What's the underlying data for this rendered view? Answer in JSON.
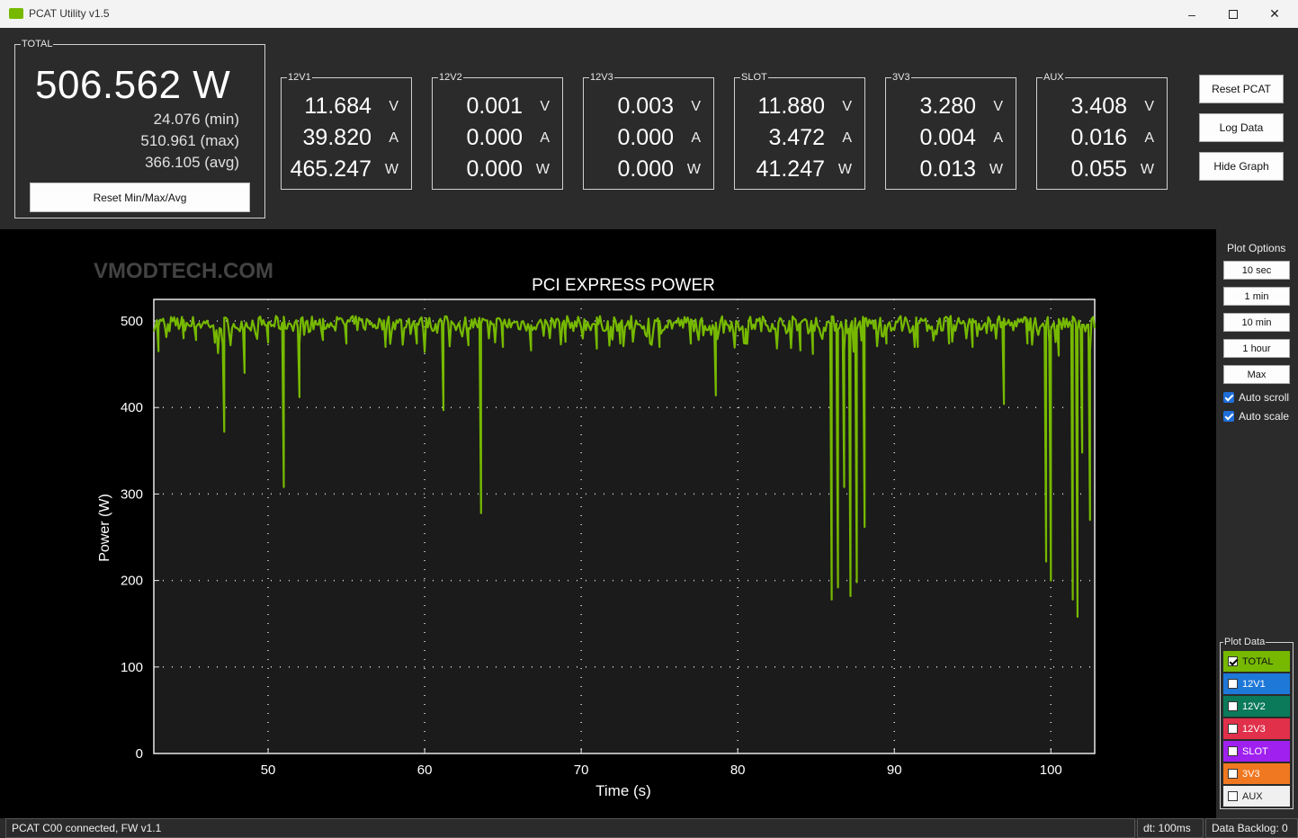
{
  "window": {
    "title": "PCAT Utility v1.5"
  },
  "total": {
    "label": "TOTAL",
    "watts": "506.562 W",
    "min": "24.076 (min)",
    "max": "510.961 (max)",
    "avg": "366.105 (avg)",
    "reset_label": "Reset Min/Max/Avg"
  },
  "rails": [
    {
      "name": "12V1",
      "volts": "11.684",
      "amps": "39.820",
      "watts": "465.247"
    },
    {
      "name": "12V2",
      "volts": "0.001",
      "amps": "0.000",
      "watts": "0.000"
    },
    {
      "name": "12V3",
      "volts": "0.003",
      "amps": "0.000",
      "watts": "0.000"
    },
    {
      "name": "SLOT",
      "volts": "11.880",
      "amps": "3.472",
      "watts": "41.247"
    },
    {
      "name": "3V3",
      "volts": "3.280",
      "amps": "0.004",
      "watts": "0.013"
    },
    {
      "name": "AUX",
      "volts": "3.408",
      "amps": "0.016",
      "watts": "0.055"
    }
  ],
  "units": {
    "v": "V",
    "a": "A",
    "w": "W"
  },
  "actions": {
    "reset_pcat": "Reset PCAT",
    "log_data": "Log Data",
    "hide_graph": "Hide Graph"
  },
  "plot_options": {
    "title": "Plot Options",
    "ranges": [
      "10 sec",
      "1 min",
      "10 min",
      "1 hour",
      "Max"
    ],
    "auto_scroll": "Auto scroll",
    "auto_scale": "Auto scale"
  },
  "plot_data": {
    "title": "Plot Data",
    "items": [
      {
        "label": "TOTAL",
        "color": "#76b900",
        "checked": true
      },
      {
        "label": "12V1",
        "color": "#1e78d8",
        "checked": false
      },
      {
        "label": "12V2",
        "color": "#0a7a5a",
        "checked": false
      },
      {
        "label": "12V3",
        "color": "#e0304a",
        "checked": false
      },
      {
        "label": "SLOT",
        "color": "#a020f0",
        "checked": false
      },
      {
        "label": "3V3",
        "color": "#f07820",
        "checked": false
      },
      {
        "label": "AUX",
        "color": "#f0f0f0",
        "checked": false
      }
    ]
  },
  "watermark": "VMODTECH.COM",
  "status": {
    "connection": "PCAT C00 connected, FW v1.1",
    "dt": "dt: 100ms",
    "backlog": "Data Backlog: 0"
  },
  "chart_data": {
    "type": "line",
    "title": "PCI EXPRESS POWER",
    "xlabel": "Time (s)",
    "ylabel": "Power (W)",
    "xlim": [
      42.7,
      102.8
    ],
    "ylim": [
      0,
      525
    ],
    "xticks": [
      50,
      60,
      70,
      80,
      90,
      100
    ],
    "yticks": [
      0,
      100,
      200,
      300,
      400,
      500
    ],
    "grid": true,
    "series": [
      {
        "name": "TOTAL",
        "color": "#76b900",
        "baseline": 497,
        "dips": [
          {
            "x": 43.0,
            "y": 465
          },
          {
            "x": 44.6,
            "y": 480
          },
          {
            "x": 45.4,
            "y": 478
          },
          {
            "x": 46.6,
            "y": 475
          },
          {
            "x": 47.2,
            "y": 372
          },
          {
            "x": 48.5,
            "y": 440
          },
          {
            "x": 50.0,
            "y": 475
          },
          {
            "x": 51.0,
            "y": 308
          },
          {
            "x": 52.0,
            "y": 412
          },
          {
            "x": 53.5,
            "y": 478
          },
          {
            "x": 55.0,
            "y": 474
          },
          {
            "x": 57.5,
            "y": 470
          },
          {
            "x": 59.5,
            "y": 474
          },
          {
            "x": 61.2,
            "y": 397
          },
          {
            "x": 62.8,
            "y": 472
          },
          {
            "x": 63.6,
            "y": 278
          },
          {
            "x": 65.0,
            "y": 470
          },
          {
            "x": 66.8,
            "y": 466
          },
          {
            "x": 69.0,
            "y": 476
          },
          {
            "x": 71.0,
            "y": 468
          },
          {
            "x": 72.5,
            "y": 474
          },
          {
            "x": 75.0,
            "y": 470
          },
          {
            "x": 77.0,
            "y": 474
          },
          {
            "x": 78.6,
            "y": 414
          },
          {
            "x": 80.5,
            "y": 474
          },
          {
            "x": 82.5,
            "y": 470
          },
          {
            "x": 84.0,
            "y": 466
          },
          {
            "x": 84.8,
            "y": 462
          },
          {
            "x": 86.0,
            "y": 178
          },
          {
            "x": 86.4,
            "y": 192
          },
          {
            "x": 86.8,
            "y": 308
          },
          {
            "x": 87.2,
            "y": 182
          },
          {
            "x": 87.6,
            "y": 198
          },
          {
            "x": 88.1,
            "y": 262
          },
          {
            "x": 89.5,
            "y": 474
          },
          {
            "x": 91.5,
            "y": 470
          },
          {
            "x": 93.5,
            "y": 474
          },
          {
            "x": 95.0,
            "y": 470
          },
          {
            "x": 97.0,
            "y": 404
          },
          {
            "x": 98.5,
            "y": 474
          },
          {
            "x": 99.7,
            "y": 222
          },
          {
            "x": 100.0,
            "y": 200
          },
          {
            "x": 100.5,
            "y": 460
          },
          {
            "x": 101.4,
            "y": 178
          },
          {
            "x": 101.7,
            "y": 158
          },
          {
            "x": 102.0,
            "y": 348
          },
          {
            "x": 102.5,
            "y": 270
          }
        ]
      }
    ]
  }
}
